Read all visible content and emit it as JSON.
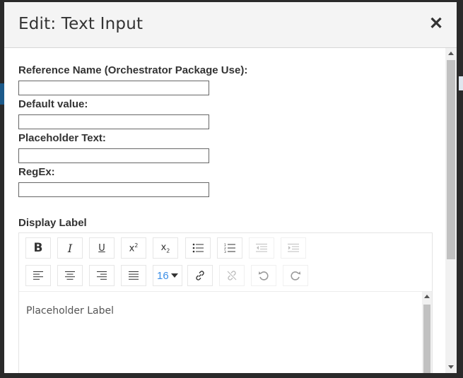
{
  "dialog": {
    "title": "Edit: Text Input",
    "close_icon": "close-icon"
  },
  "fields": [
    {
      "label": "Reference Name (Orchestrator Package Use):",
      "value": "",
      "placeholder": ""
    },
    {
      "label": "Default value:",
      "value": "",
      "placeholder": ""
    },
    {
      "label": "Placeholder Text:",
      "value": "",
      "placeholder": ""
    },
    {
      "label": "RegEx:",
      "value": "",
      "placeholder": ""
    }
  ],
  "display_label": {
    "heading": "Display Label",
    "content": "Placeholder Label"
  },
  "toolbar": {
    "row1": [
      {
        "name": "bold-button",
        "icon": "bold-icon",
        "enabled": true
      },
      {
        "name": "italic-button",
        "icon": "italic-icon",
        "enabled": true
      },
      {
        "name": "underline-button",
        "icon": "underline-icon",
        "enabled": true
      },
      {
        "name": "superscript-button",
        "icon": "superscript-icon",
        "enabled": true
      },
      {
        "name": "subscript-button",
        "icon": "subscript-icon",
        "enabled": true
      },
      {
        "name": "bullet-list-button",
        "icon": "bullet-list-icon",
        "enabled": true
      },
      {
        "name": "numbered-list-button",
        "icon": "numbered-list-icon",
        "enabled": true
      },
      {
        "name": "outdent-button",
        "icon": "outdent-icon",
        "enabled": false
      },
      {
        "name": "indent-button",
        "icon": "indent-icon",
        "enabled": false
      }
    ],
    "row2": [
      {
        "name": "align-left-button",
        "icon": "align-left-icon",
        "enabled": true
      },
      {
        "name": "align-center-button",
        "icon": "align-center-icon",
        "enabled": true
      },
      {
        "name": "align-right-button",
        "icon": "align-right-icon",
        "enabled": true
      },
      {
        "name": "justify-button",
        "icon": "justify-icon",
        "enabled": true
      },
      {
        "name": "link-button",
        "icon": "link-icon",
        "enabled": true
      },
      {
        "name": "unlink-button",
        "icon": "unlink-icon",
        "enabled": false
      },
      {
        "name": "undo-button",
        "icon": "undo-icon",
        "enabled": false
      },
      {
        "name": "redo-button",
        "icon": "redo-icon",
        "enabled": false
      }
    ],
    "font_size": "16"
  },
  "colors": {
    "accent": "#3a8ee6",
    "header_bg": "#f4f4f4",
    "text": "#333333"
  }
}
